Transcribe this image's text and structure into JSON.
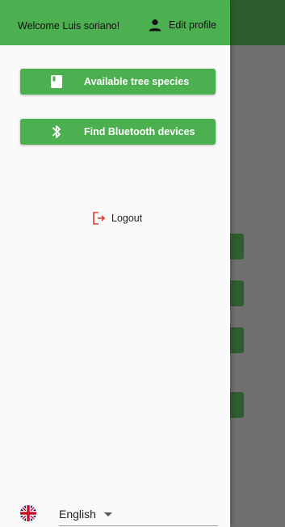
{
  "header": {
    "welcome": "Welcome Luis soriano!",
    "edit_profile": "Edit profile"
  },
  "actions": {
    "species_label": "Available tree species",
    "bluetooth_label": "Find Bluetooth devices"
  },
  "logout": {
    "label": "Logout"
  },
  "language": {
    "selected": "English"
  },
  "colors": {
    "primary": "#4caf50",
    "logout_icon": "#e53935",
    "scrim_background": "#6f6f6f"
  },
  "icons": {
    "edit_profile": "person-icon",
    "species": "book-icon",
    "bluetooth": "bluetooth-icon",
    "logout": "logout-icon",
    "language": "uk-flag-icon"
  }
}
